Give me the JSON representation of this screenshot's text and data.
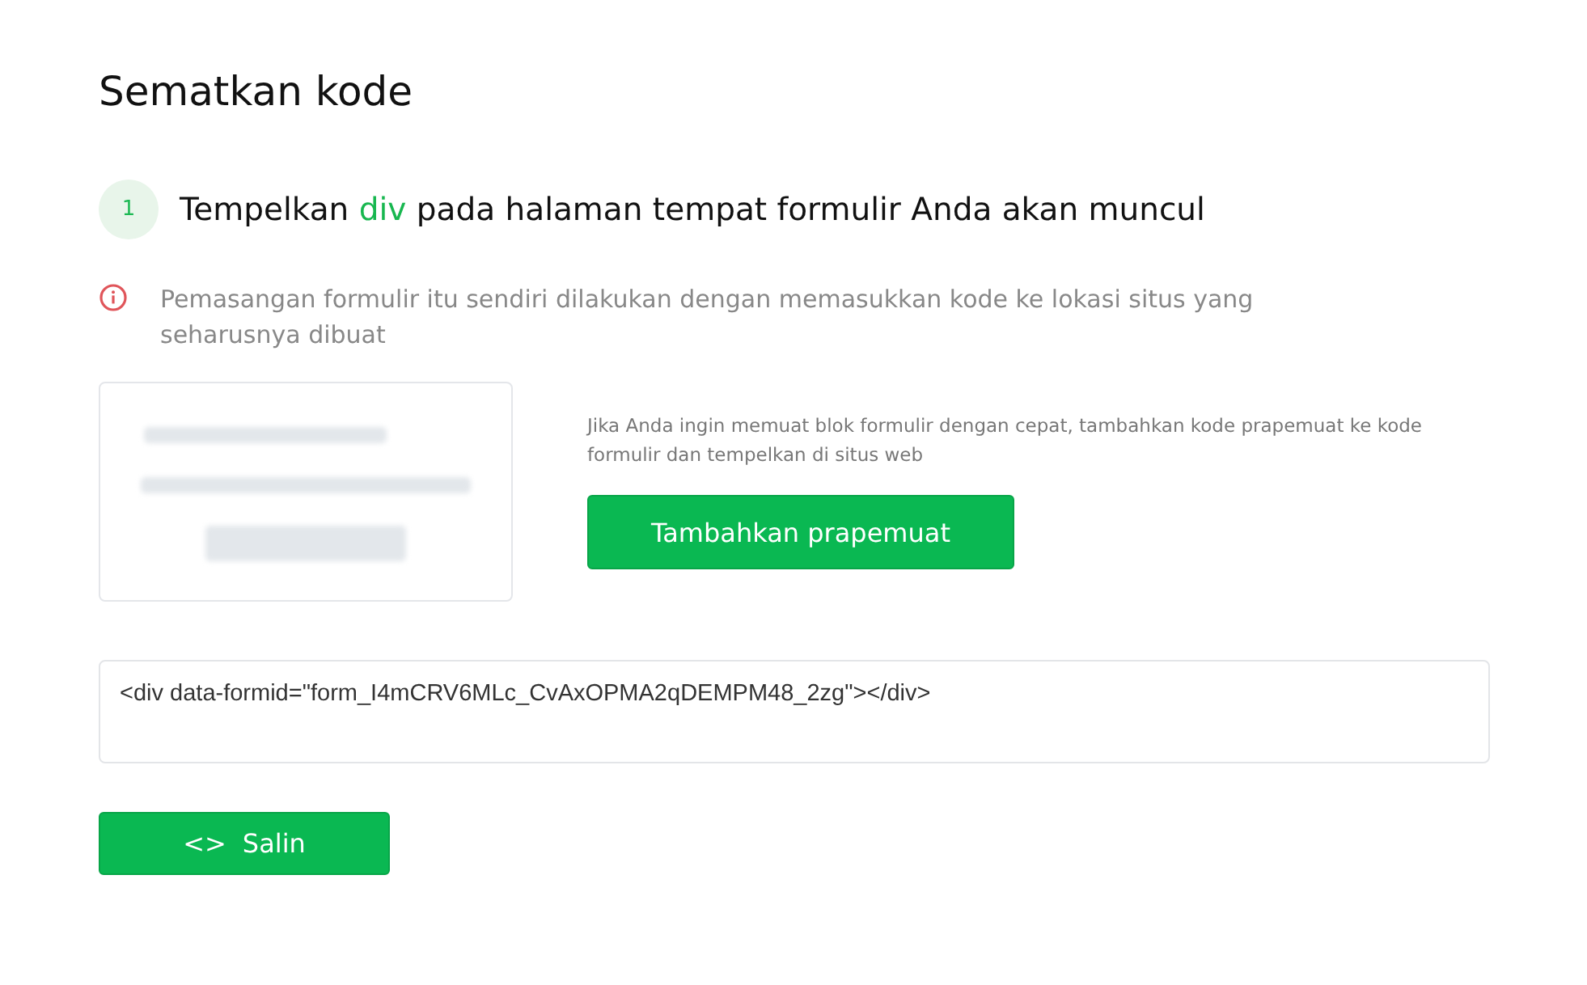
{
  "title": "Sematkan kode",
  "step": {
    "number": "1",
    "heading_before": "Tempelkan",
    "heading_highlight": "div",
    "heading_after": "pada halaman tempat formulir Anda akan muncul"
  },
  "notice": "Pemasangan formulir itu sendiri dilakukan dengan memasukkan kode ke lokasi situs yang seharusnya dibuat",
  "preloader": {
    "description": "Jika Anda ingin memuat blok formulir dengan cepat, tambahkan kode prapemuat ke kode formulir dan tempelkan di situs web",
    "button": "Tambahkan prapemuat"
  },
  "code": "<div data-formid=\"form_I4mCRV6MLc_CvAxOPMA2qDEMPM48_2zg\"></div>",
  "copy_button": {
    "glyph": "<>",
    "label": "Salin"
  }
}
